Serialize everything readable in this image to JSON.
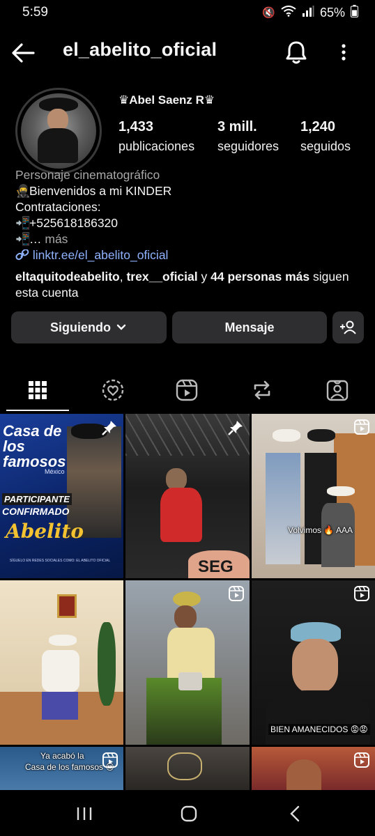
{
  "status_bar": {
    "time": "5:59",
    "battery": "65%"
  },
  "profile": {
    "username": "el_abelito_oficial",
    "display_name": "♛Abel Saenz R♛",
    "stats": [
      {
        "value": "1,433",
        "label": "publicaciones"
      },
      {
        "value": "3 mill.",
        "label": "seguidores"
      },
      {
        "value": "1,240",
        "label": "seguidos"
      }
    ],
    "bio": {
      "category": "Personaje cinematográfico",
      "line1": "Bienvenidos a mi KINDER",
      "line2": "Contrataciones:",
      "line3": "+525618186320",
      "line4": "…",
      "more": "más",
      "link": "linktr.ee/el_abelito_oficial"
    },
    "followed_by": {
      "user1": "eltaquitodeabelito",
      "sep": ",",
      "user2": "trex__oficial",
      "conj": "y",
      "others": "44 personas más",
      "tail": "siguen esta cuenta"
    }
  },
  "buttons": {
    "following": "Siguiendo",
    "message": "Mensaje"
  },
  "tabs": [
    "grid-icon",
    "reels-circle-icon",
    "reels-icon",
    "reposts-icon",
    "tagged-icon"
  ],
  "grid": {
    "post1": {
      "title1": "Casa de los famosos",
      "title2": "México",
      "sub1": "PARTICIPANTE",
      "sub2": "CONFIRMADO",
      "name": "Abelito",
      "footer": "SÍGUELO EN REDES SOCIALES COMO: EL ABELITO OFICIAL"
    },
    "post3": {
      "caption": "Volvimos 🔥 AAA"
    },
    "post6": {
      "caption": "BIEN AMANECIDOS 😡😡"
    },
    "post7": {
      "caption1": "Ya acabó la",
      "caption2": "Casa de los famosos 😔"
    }
  },
  "colors": {
    "background": "#000000",
    "button": "#2e2e30",
    "link": "#8fb3ff",
    "muted": "#a8a8a8"
  }
}
